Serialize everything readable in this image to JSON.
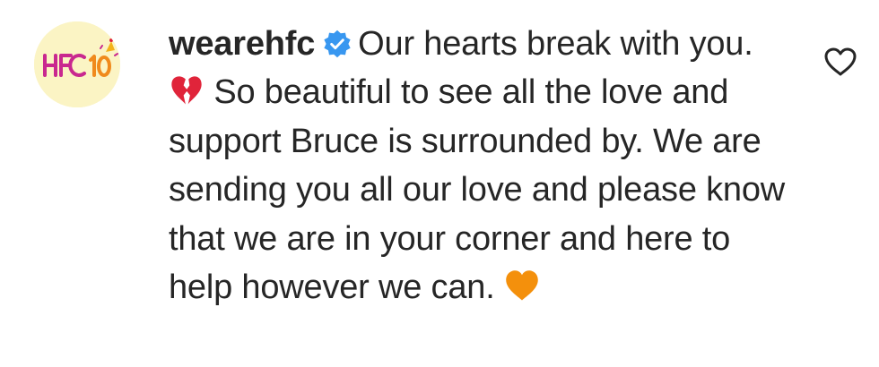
{
  "comment": {
    "avatar_icon": "hfc-10-logo-icon",
    "avatar_text": "HFC 10",
    "username": "wearehfc",
    "verified_icon": "verified-badge-icon",
    "text_part1": "Our hearts break with you.",
    "emoji1": "broken-heart-icon",
    "text_part2": "So beautiful to see all the love and support Bruce is surrounded by. We are sending you all our love and please know that we are in your corner and here to help however we can.",
    "emoji2": "orange-heart-icon",
    "like_icon": "heart-outline-icon"
  },
  "colors": {
    "avatar_bg": "#fbf4c4",
    "verified_blue": "#3897f0",
    "text": "#262626",
    "broken_heart": "#e0243a",
    "orange_heart": "#f4900c"
  }
}
